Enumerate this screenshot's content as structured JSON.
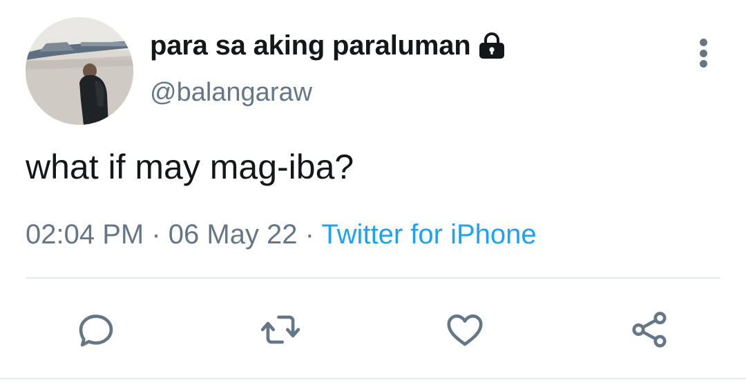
{
  "user": {
    "display_name": "para sa aking paraluman",
    "handle": "@balangaraw",
    "protected_icon": "lock-icon",
    "avatar": "photo of person in dark hoodie by river with bridge"
  },
  "tweet": {
    "text": "what if may mag-iba?",
    "time": "02:04 PM",
    "separator": " · ",
    "date": "06 May 22",
    "source": "Twitter for iPhone"
  },
  "actions": {
    "more": "more-vertical-icon",
    "reply": "reply-icon",
    "retweet": "retweet-icon",
    "like": "heart-icon",
    "share": "share-icon"
  },
  "colors": {
    "text_primary": "#14171a",
    "text_secondary": "#657786",
    "link": "#1da1f2",
    "divider": "#e6ecf0"
  }
}
